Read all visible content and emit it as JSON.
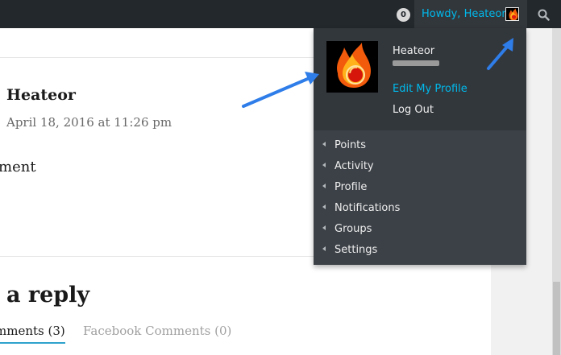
{
  "admin_bar": {
    "notification_count": "0",
    "howdy_text": "Howdy, Heateor"
  },
  "comment": {
    "author": "Heateor",
    "date": "April 18, 2016 at 11:26 pm",
    "body_partial": "ment"
  },
  "reply_section": {
    "heading_partial": "a reply",
    "tabs": [
      {
        "label": "mments (3)",
        "active": true
      },
      {
        "label": "Facebook Comments (0)",
        "active": false
      }
    ]
  },
  "dropdown": {
    "name": "Heateor",
    "username": "••••••••",
    "edit_profile": "Edit My Profile",
    "log_out": "Log Out",
    "submenu": [
      {
        "label": "Points"
      },
      {
        "label": "Activity"
      },
      {
        "label": "Profile"
      },
      {
        "label": "Notifications"
      },
      {
        "label": "Groups"
      },
      {
        "label": "Settings"
      }
    ]
  },
  "colors": {
    "admin_bar": "#23282d",
    "accent": "#00b9eb",
    "annotation_arrow": "#2e7de9"
  }
}
